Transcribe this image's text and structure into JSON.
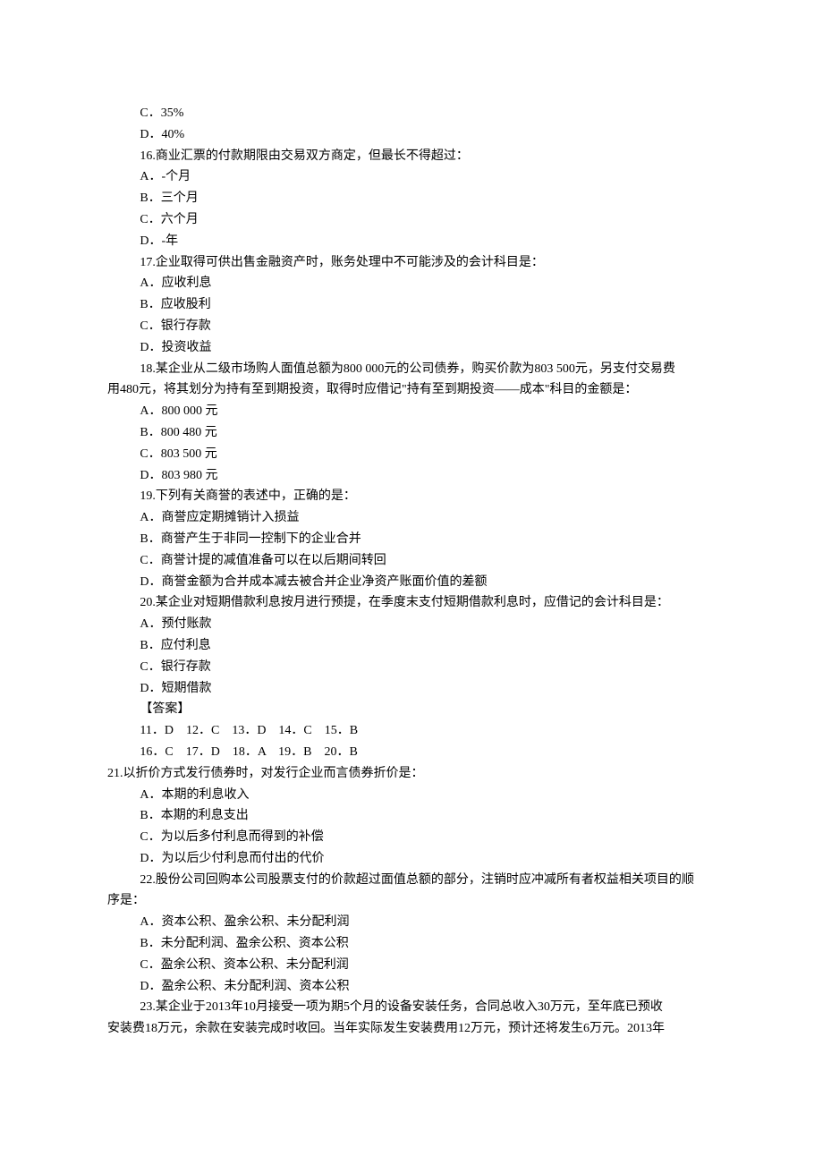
{
  "lines": [
    {
      "cls": "line",
      "text": "C．35%"
    },
    {
      "cls": "line",
      "text": "D．40%"
    },
    {
      "cls": "line",
      "text": "16.商业汇票的付款期限由交易双方商定，但最长不得超过："
    },
    {
      "cls": "line",
      "text": "A．-个月"
    },
    {
      "cls": "line",
      "text": "B．三个月"
    },
    {
      "cls": "line",
      "text": "C．六个月"
    },
    {
      "cls": "line",
      "text": "D．-年"
    },
    {
      "cls": "line",
      "text": "17.企业取得可供出售金融资产时，账务处理中不可能涉及的会计科目是："
    },
    {
      "cls": "line",
      "text": "A．应收利息"
    },
    {
      "cls": "line",
      "text": "B．应收股利"
    },
    {
      "cls": "line",
      "text": "C．银行存款"
    },
    {
      "cls": "line",
      "text": "D．投资收益"
    },
    {
      "cls": "line",
      "text": "18.某企业从二级市场购人面值总额为800 000元的公司债券，购买价款为803 500元，另支付交易费"
    },
    {
      "cls": "line-noindent",
      "text": "用480元，将其划分为持有至到期投资，取得时应借记\"持有至到期投资——成本\"科目的金额是："
    },
    {
      "cls": "line",
      "text": "A．800 000 元"
    },
    {
      "cls": "line",
      "text": "B．800 480 元"
    },
    {
      "cls": "line",
      "text": "C．803 500 元"
    },
    {
      "cls": "line",
      "text": "D．803 980 元"
    },
    {
      "cls": "line",
      "text": "19.下列有关商誉的表述中，正确的是："
    },
    {
      "cls": "line",
      "text": "A．商誉应定期摊销计入损益"
    },
    {
      "cls": "line",
      "text": "B．商誉产生于非同一控制下的企业合并"
    },
    {
      "cls": "line",
      "text": "C．商誉计提的减值准备可以在以后期间转回"
    },
    {
      "cls": "line",
      "text": "D．商誉金额为合并成本减去被合并企业净资产账面价值的差额"
    },
    {
      "cls": "line",
      "text": "20.某企业对短期借款利息按月进行预提，在季度末支付短期借款利息时，应借记的会计科目是："
    },
    {
      "cls": "line",
      "text": "A．预付账款"
    },
    {
      "cls": "line",
      "text": "B．应付利息"
    },
    {
      "cls": "line",
      "text": "C．银行存款"
    },
    {
      "cls": "line",
      "text": "D．短期借款"
    },
    {
      "cls": "line",
      "text": "【答案】"
    },
    {
      "cls": "ans-row",
      "text": "11．D    12．C    13．D    14．C    15．B"
    },
    {
      "cls": "ans-row",
      "text": "16．C    17．D    18．A    19．B    20．B"
    },
    {
      "cls": "line-noindent",
      "text": "21.以折价方式发行债券时，对发行企业而言债券折价是："
    },
    {
      "cls": "line",
      "text": "A．本期的利息收入"
    },
    {
      "cls": "line",
      "text": "B．本期的利息支出"
    },
    {
      "cls": "line",
      "text": "C．为以后多付利息而得到的补偿"
    },
    {
      "cls": "line",
      "text": "D．为以后少付利息而付出的代价"
    },
    {
      "cls": "line",
      "text": "22.股份公司回购本公司股票支付的价款超过面值总额的部分，注销时应冲减所有者权益相关项目的顺"
    },
    {
      "cls": "line-noindent",
      "text": "序是："
    },
    {
      "cls": "line",
      "text": "A．资本公积、盈余公积、未分配利润"
    },
    {
      "cls": "line",
      "text": "B．未分配利润、盈余公积、资本公积"
    },
    {
      "cls": "line",
      "text": "C．盈余公积、资本公积、未分配利润"
    },
    {
      "cls": "line",
      "text": "D．盈余公积、未分配利润、资本公积"
    },
    {
      "cls": "line",
      "text": "23.某企业于2013年10月接受一项为期5个月的设备安装任务，合同总收入30万元，至年底已预收"
    },
    {
      "cls": "line-noindent",
      "text": "安装费18万元，余款在安装完成时收回。当年实际发生安装费用12万元，预计还将发生6万元。2013年"
    }
  ]
}
